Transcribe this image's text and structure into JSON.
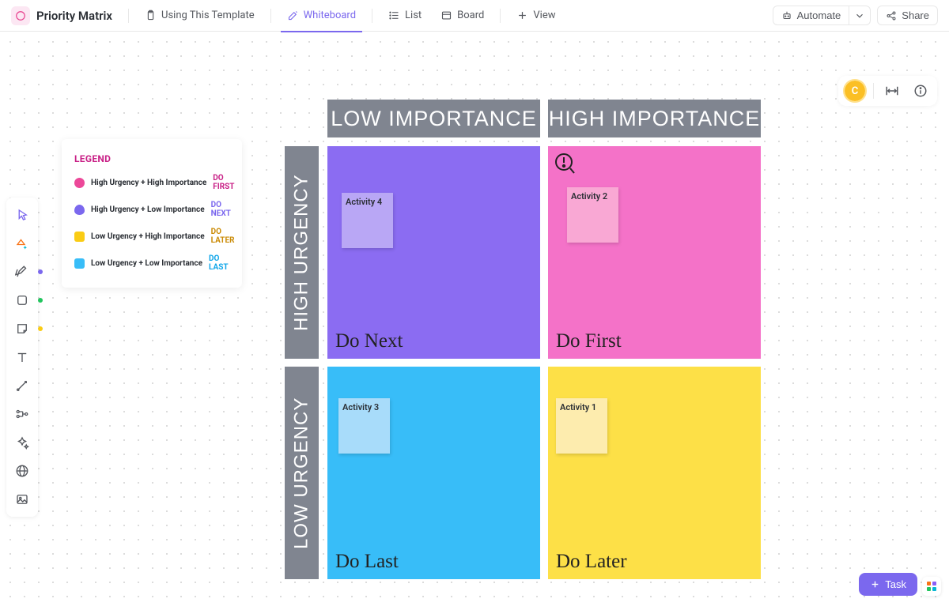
{
  "header": {
    "title": "Priority Matrix",
    "tabs": [
      {
        "label": "Using This Template"
      },
      {
        "label": "Whiteboard"
      },
      {
        "label": "List"
      },
      {
        "label": "Board"
      }
    ],
    "add_view": "View",
    "automate": "Automate",
    "share": "Share"
  },
  "avatar_letter": "C",
  "legend": {
    "title": "LEGEND",
    "items": [
      {
        "label": "High Urgency + High Importance",
        "tag": "DO FIRST",
        "swatch": "#ec4899",
        "tag_color": "#c81e85"
      },
      {
        "label": "High Urgency + Low Importance",
        "tag": "DO NEXT",
        "swatch": "#7b68ee",
        "tag_color": "#7b68ee"
      },
      {
        "label": "Low Urgency + High Importance",
        "tag": "DO LATER",
        "swatch": "#facc15",
        "tag_color": "#ca8a04"
      },
      {
        "label": "Low Urgency + Low Importance",
        "tag": "DO LAST",
        "swatch": "#38bdf8",
        "tag_color": "#0ea5e9"
      }
    ]
  },
  "matrix": {
    "col_headers": [
      "LOW IMPORTANCE",
      "HIGH IMPORTANCE"
    ],
    "row_headers": [
      "HIGH URGENCY",
      "LOW URGENCY"
    ],
    "quads": [
      {
        "label": "Do Next",
        "bg": "#8b6cf2",
        "sticky": {
          "text": "Activity 4",
          "bg": "#b9a7f5"
        }
      },
      {
        "label": "Do First",
        "bg": "#f472c8",
        "sticky": {
          "text": "Activity 2",
          "bg": "#f9a8d4"
        },
        "alert": true
      },
      {
        "label": "Do Last",
        "bg": "#38bdf8",
        "sticky": {
          "text": "Activity 3",
          "bg": "#a8dcfa"
        }
      },
      {
        "label": "Do Later",
        "bg": "#fde047",
        "sticky": {
          "text": "Activity 1",
          "bg": "#fdecae"
        }
      }
    ]
  },
  "task_button": "Task",
  "toolbar_dots": [
    "#7b68ee",
    "#22c55e",
    "#facc15"
  ]
}
